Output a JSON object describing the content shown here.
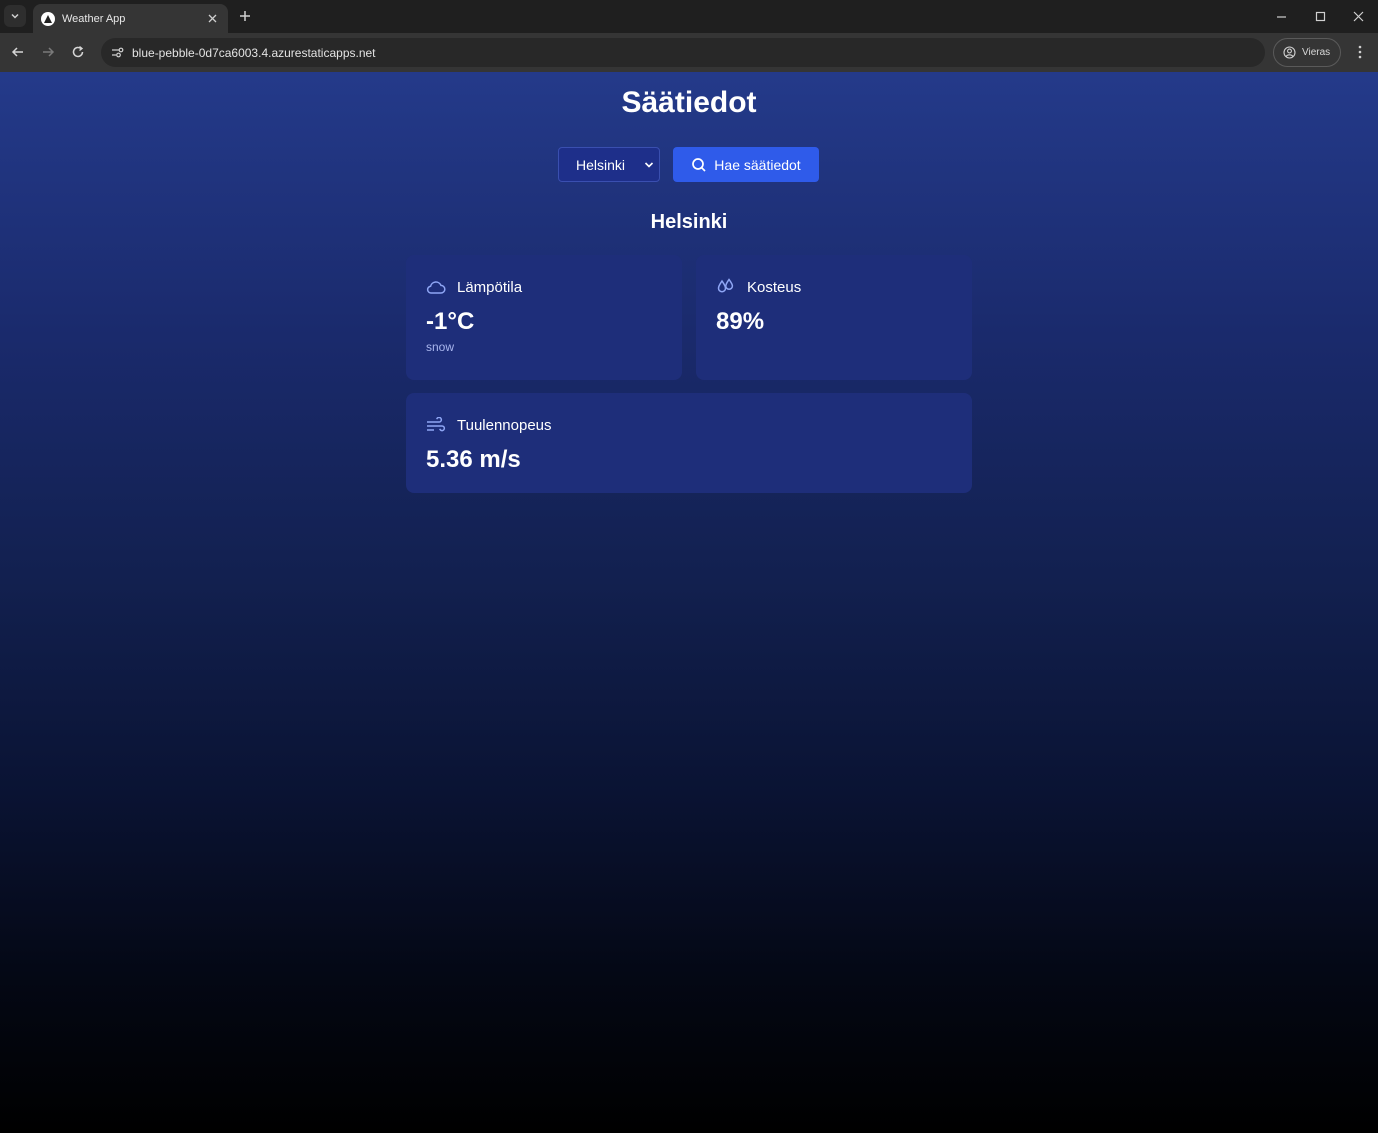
{
  "browser": {
    "tab_title": "Weather App",
    "url": "blue-pebble-0d7ca6003.4.azurestaticapps.net",
    "profile_label": "Vieras"
  },
  "app": {
    "title": "Säätiedot",
    "city_select": {
      "selected": "Helsinki"
    },
    "fetch_button_label": "Hae säätiedot",
    "city_heading": "Helsinki"
  },
  "cards": {
    "temperature": {
      "label": "Lämpötila",
      "value": "-1°C",
      "description": "snow",
      "icon": "cloud-icon"
    },
    "humidity": {
      "label": "Kosteus",
      "value": "89%",
      "icon": "droplets-icon"
    },
    "wind": {
      "label": "Tuulennopeus",
      "value": "5.36 m/s",
      "icon": "wind-icon"
    }
  },
  "colors": {
    "accent": "#2f5bea",
    "card_background": "#1e2e7a",
    "icon_color": "#8fa6f5"
  }
}
